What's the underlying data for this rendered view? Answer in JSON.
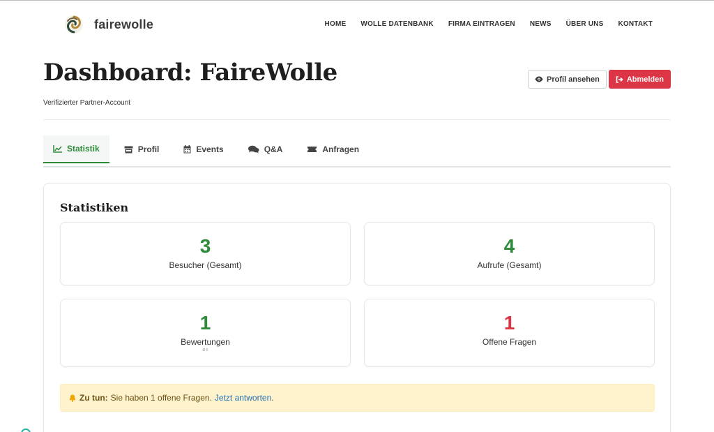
{
  "site": {
    "brand": "fairewolle"
  },
  "nav": [
    "HOME",
    "WOLLE DATENBANK",
    "FIRMA EINTRAGEN",
    "NEWS",
    "ÜBER UNS",
    "KONTAKT"
  ],
  "page": {
    "title": "Dashboard: FaireWolle",
    "subtitle": "Verifizierter Partner-Account",
    "view_profile": "Profil ansehen",
    "logout": "Abmelden"
  },
  "tabs": [
    {
      "label": "Statistik",
      "icon": "chart-line-icon",
      "active": true
    },
    {
      "label": "Profil",
      "icon": "store-icon",
      "active": false
    },
    {
      "label": "Events",
      "icon": "calendar-icon",
      "active": false
    },
    {
      "label": "Q&A",
      "icon": "comments-icon",
      "active": false
    },
    {
      "label": "Anfragen",
      "icon": "ticket-icon",
      "active": false
    }
  ],
  "stats": {
    "title": "Statistiken",
    "visitors": {
      "value": "3",
      "label": "Besucher (Gesamt)"
    },
    "views": {
      "value": "4",
      "label": "Aufrufe (Gesamt)"
    },
    "ratings": {
      "value": "1",
      "label": "Bewertungen",
      "sub": "Ø 5"
    },
    "questions": {
      "value": "1",
      "label": "Offene Fragen"
    }
  },
  "alert": {
    "strong": "Zu tun:",
    "text": "Sie haben 1 offene Fragen.",
    "link": "Jetzt antworten",
    "tail": "."
  },
  "colors": {
    "accent": "#2e8b3a",
    "danger": "#dc3545",
    "alert_bg": "#fff3cd",
    "link": "#1f6fb5"
  }
}
